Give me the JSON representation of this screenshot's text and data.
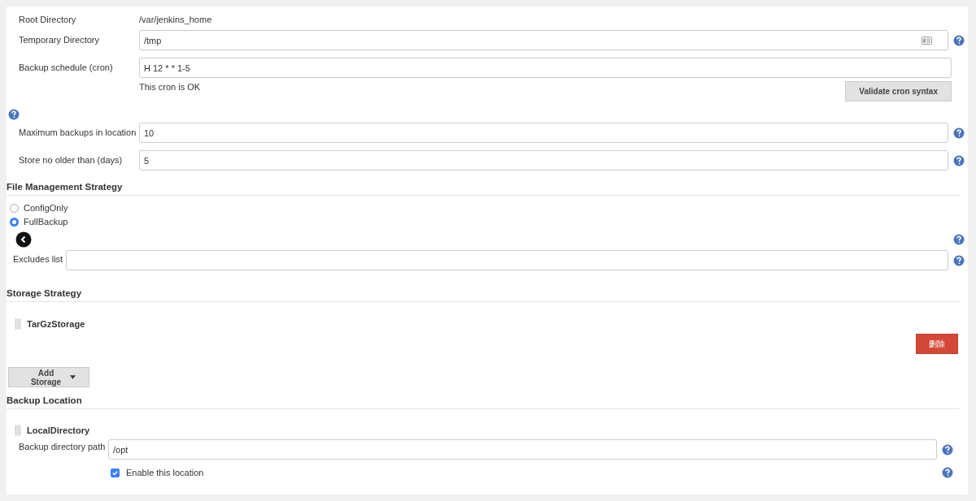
{
  "general": {
    "root_directory": {
      "label": "Root Directory",
      "value": "/var/jenkins_home"
    },
    "temporary_directory": {
      "label": "Temporary Directory",
      "value": "/tmp"
    },
    "backup_schedule": {
      "label": "Backup schedule (cron)",
      "value": "H 12 * * 1-5",
      "message": "This cron is OK",
      "button": "Validate cron syntax"
    },
    "maximum_backups": {
      "label": "Maximum backups in location",
      "value": "10"
    },
    "store_no_older": {
      "label": "Store no older than (days)",
      "value": "5"
    }
  },
  "file_management": {
    "title": "File Management Strategy",
    "options": [
      {
        "label": "ConfigOnly",
        "selected": false
      },
      {
        "label": "FullBackup",
        "selected": true
      }
    ],
    "excludes": {
      "label": "Excludes list"
    }
  },
  "storage_strategy": {
    "title": "Storage Strategy",
    "item": "TarGzStorage",
    "delete_button": "删除",
    "add_button": "Add Storage"
  },
  "backup_location": {
    "title": "Backup Location",
    "item": "LocalDirectory",
    "path": {
      "label": "Backup directory path",
      "value": "/opt"
    },
    "enable": {
      "label": "Enable this location",
      "checked": true
    }
  }
}
